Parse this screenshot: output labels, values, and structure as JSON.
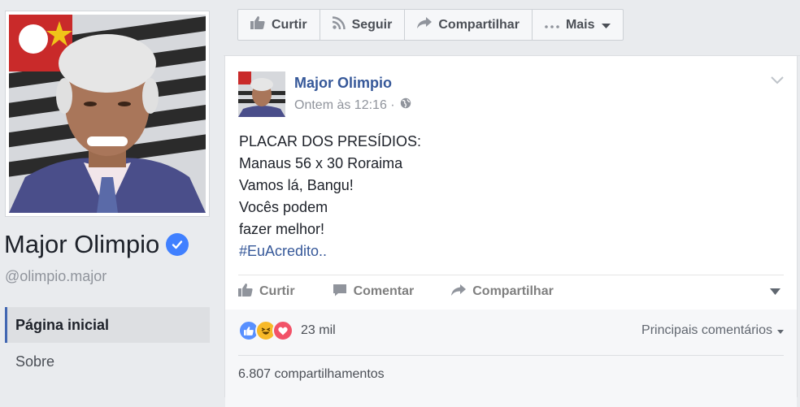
{
  "page": {
    "name": "Major Olimpio",
    "handle": "@olimpio.major",
    "nav": [
      {
        "label": "Página inicial"
      },
      {
        "label": "Sobre"
      }
    ]
  },
  "actions": [
    {
      "label": "Curtir",
      "icon": "thumbs-up-icon"
    },
    {
      "label": "Seguir",
      "icon": "rss-icon"
    },
    {
      "label": "Compartilhar",
      "icon": "share-arrow-icon"
    },
    {
      "label": "Mais",
      "icon": "ellipsis-icon"
    }
  ],
  "post": {
    "author": "Major Olimpio",
    "timestamp": "Ontem às 12:16 ·",
    "lines": [
      "PLACAR DOS PRESÍDIOS:",
      "Manaus 56 x 30 Roraima",
      "Vamos lá, Bangu!",
      "Vocês podem",
      "fazer melhor!"
    ],
    "hashtag": "#EuAcredito..",
    "buttons": {
      "like": "Curtir",
      "comment": "Comentar",
      "share": "Compartilhar"
    },
    "reactions": {
      "count": "23 mil",
      "types": [
        "like",
        "haha",
        "love"
      ]
    },
    "sort_label": "Principais comentários",
    "shares": "6.807 compartilhamentos"
  },
  "colors": {
    "link_blue": "#365899",
    "like_blue": "#5890ff",
    "haha_yellow": "#f7b928",
    "love_red": "#f25268",
    "verified_blue": "#4080ff"
  }
}
